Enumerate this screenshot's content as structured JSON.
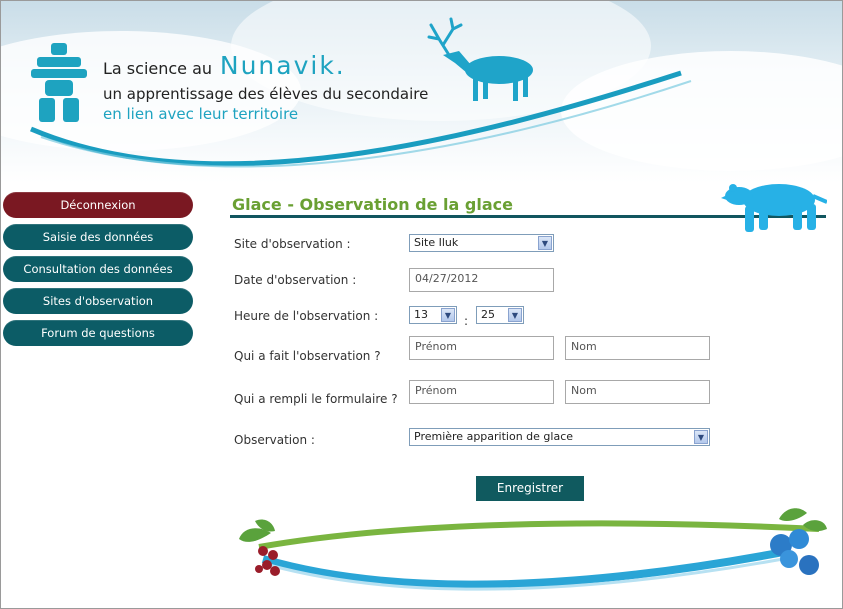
{
  "header": {
    "logo_prefix": "La science au",
    "logo_name": "Nunavik.",
    "tagline_line1": "un apprentissage des élèves du secondaire",
    "tagline_line2": "en lien avec leur territoire"
  },
  "sidebar": {
    "items": [
      {
        "label": "Déconnexion",
        "active": true
      },
      {
        "label": "Saisie des données"
      },
      {
        "label": "Consultation des données"
      },
      {
        "label": "Sites d'observation"
      },
      {
        "label": "Forum de questions"
      }
    ]
  },
  "page": {
    "title": "Glace - Observation de la glace"
  },
  "form": {
    "site": {
      "label": "Site d'observation :",
      "value": "Site Iluk"
    },
    "date": {
      "label": "Date d'observation :",
      "value": "04/27/2012"
    },
    "time": {
      "label": "Heure de l'observation :",
      "hour": "13",
      "separator": ":",
      "minute": "25"
    },
    "observer": {
      "label": "Qui a fait l'observation ?",
      "first_placeholder": "Prénom",
      "last_placeholder": "Nom"
    },
    "filler": {
      "label": "Qui a rempli le formulaire ?",
      "first_placeholder": "Prénom",
      "last_placeholder": "Nom"
    },
    "observation": {
      "label": "Observation :",
      "value": "Première apparition de glace"
    },
    "save_label": "Enregistrer"
  },
  "colors": {
    "nav_default": "#0c5c66",
    "nav_active": "#7a1822",
    "title_green": "#6aa033",
    "accent_blue": "#1ea3c0",
    "save_button": "#105a5f"
  },
  "icons": [
    "inukshuk-icon",
    "caribou-icon",
    "polar-bear-icon",
    "cranberry-icon",
    "blueberry-icon",
    "chevron-down-icon"
  ]
}
